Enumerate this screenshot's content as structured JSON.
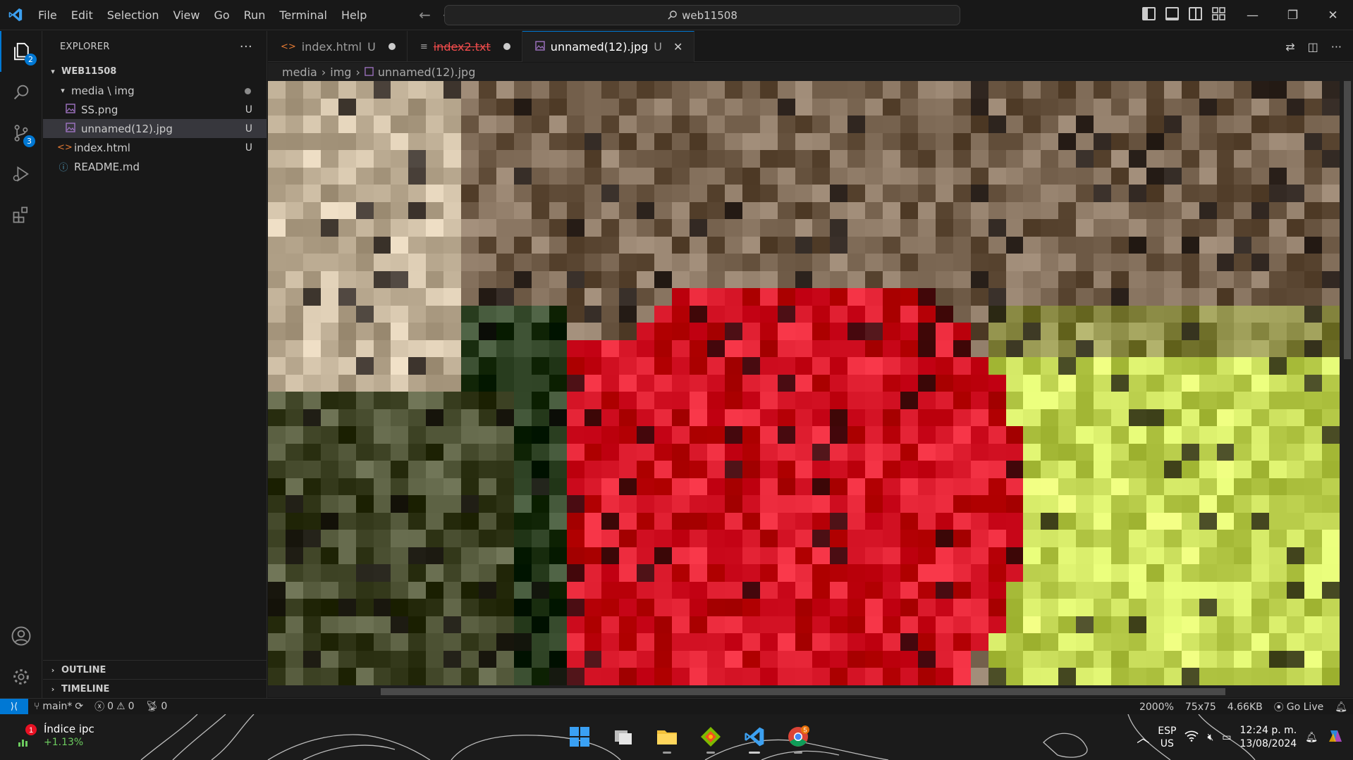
{
  "menu": [
    "File",
    "Edit",
    "Selection",
    "View",
    "Go",
    "Run",
    "Terminal",
    "Help"
  ],
  "search": {
    "text": "web11508"
  },
  "activity_badges": {
    "explorer": "2",
    "source_control": "3"
  },
  "sidebar": {
    "title": "EXPLORER",
    "more": "···",
    "root": "WEB11508",
    "items": [
      {
        "label": "media \\ img",
        "status": ""
      },
      {
        "label": "SS.png",
        "status": "U"
      },
      {
        "label": "unnamed(12).jpg",
        "status": "U"
      },
      {
        "label": "index.html",
        "status": "U"
      },
      {
        "label": "README.md",
        "status": ""
      }
    ],
    "outline": "OUTLINE",
    "timeline": "TIMELINE"
  },
  "tabs": [
    {
      "label": "index.html",
      "status": "U"
    },
    {
      "label": "index2.txt",
      "status": ""
    },
    {
      "label": "unnamed(12).jpg",
      "status": "U"
    }
  ],
  "breadcrumbs": [
    "media",
    "img",
    "unnamed(12).jpg"
  ],
  "status": {
    "branch": "main*",
    "errors": "0",
    "warnings": "0",
    "ports": "0",
    "zoom": "2000%",
    "dimensions": "75x75",
    "size": "4.66KB",
    "golive": "Go Live"
  },
  "taskbar": {
    "widget_title": "Índice ipc",
    "widget_change": "+1.13%",
    "widget_badge": "1",
    "chrome_badge": "5",
    "lang_top": "ESP",
    "lang_bottom": "US",
    "time": "12:24 p. m.",
    "date": "13/08/2024"
  },
  "colors": {
    "accent": "#0078d4",
    "deleted": "#f14c4c",
    "positive": "#6ccb5f"
  }
}
